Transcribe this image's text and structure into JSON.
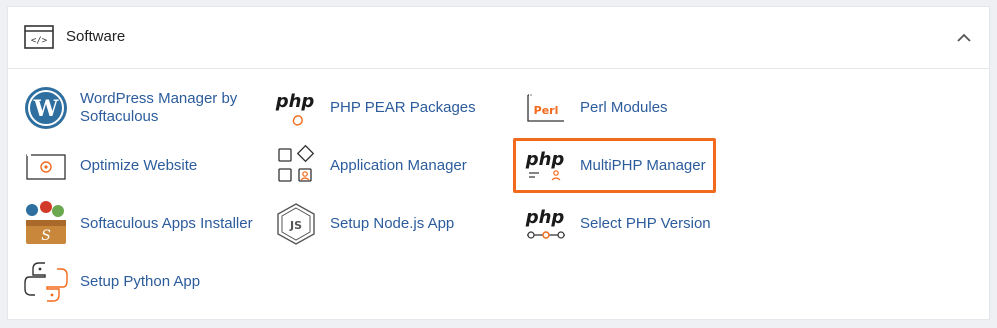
{
  "section": {
    "title": "Software",
    "collapse_icon": "chevron-up-icon"
  },
  "items": [
    {
      "label": "WordPress Manager by Softaculous",
      "icon": "wordpress-icon"
    },
    {
      "label": "PHP PEAR Packages",
      "icon": "php-pear-icon"
    },
    {
      "label": "Perl Modules",
      "icon": "perl-icon"
    },
    {
      "label": "Optimize Website",
      "icon": "optimize-website-icon"
    },
    {
      "label": "Application Manager",
      "icon": "application-manager-icon"
    },
    {
      "label": "MultiPHP Manager",
      "icon": "multiphp-icon"
    },
    {
      "label": "Softaculous Apps Installer",
      "icon": "softaculous-icon"
    },
    {
      "label": "Setup Node.js App",
      "icon": "nodejs-icon"
    },
    {
      "label": "Select PHP Version",
      "icon": "select-php-icon"
    },
    {
      "label": "Setup Python App",
      "icon": "python-icon"
    }
  ],
  "icon_text": {
    "php": "php",
    "perl": "Perl"
  },
  "colors": {
    "link": "#2c5c9c",
    "accent": "#f26a1b",
    "highlight_border": "#f26a1b"
  },
  "highlighted_item": "MultiPHP Manager"
}
